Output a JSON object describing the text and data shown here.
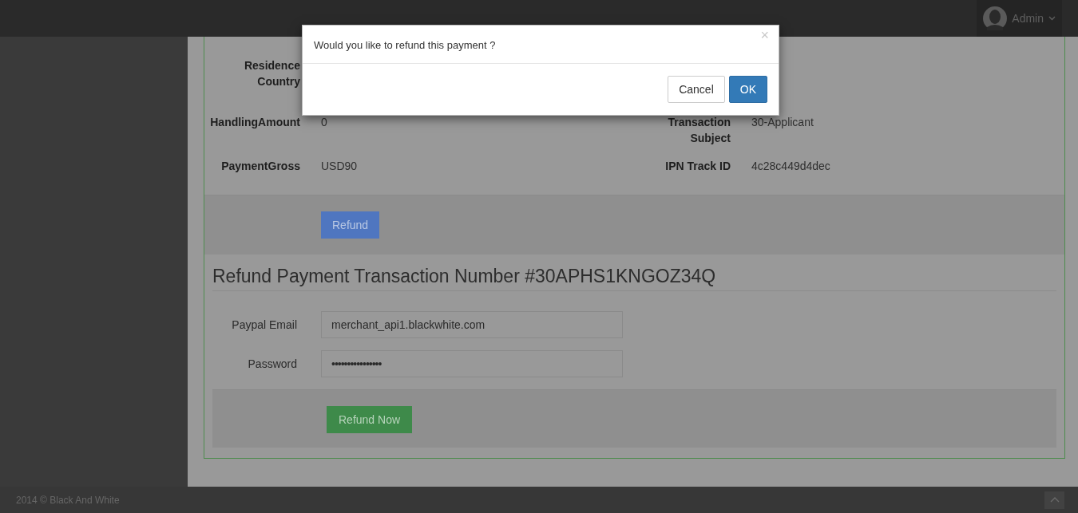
{
  "topbar": {
    "user": {
      "name": "Admin"
    }
  },
  "details": [
    {
      "left": {
        "label": "Residence Country"
      }
    },
    {
      "left": {
        "label": "HandlingAmount",
        "value": "0"
      },
      "right": {
        "label": "Transaction Subject",
        "value": "30-Applicant"
      }
    },
    {
      "left": {
        "label": "PaymentGross",
        "value": "USD90"
      },
      "right": {
        "label": "IPN Track ID",
        "value": "4c28c449d4dec"
      }
    }
  ],
  "refund_button": {
    "label": "Refund"
  },
  "refund_form": {
    "title": "Refund Payment Transaction Number #30APHS1KNGOZ34Q",
    "fields": [
      {
        "label": "Paypal Email",
        "value": "merchant_api1.blackwhite.com",
        "kind": "text"
      },
      {
        "label": "Password",
        "value": "••••••••••••••••",
        "kind": "password"
      }
    ],
    "submit": {
      "label": "Refund Now"
    }
  },
  "modal": {
    "message": "Would you like to refund this payment ?",
    "close": "×",
    "buttons": [
      {
        "label": "Cancel",
        "kind": "default"
      },
      {
        "label": "OK",
        "kind": "primary"
      }
    ]
  },
  "footer": {
    "copyright": "2014 © Black And White"
  }
}
